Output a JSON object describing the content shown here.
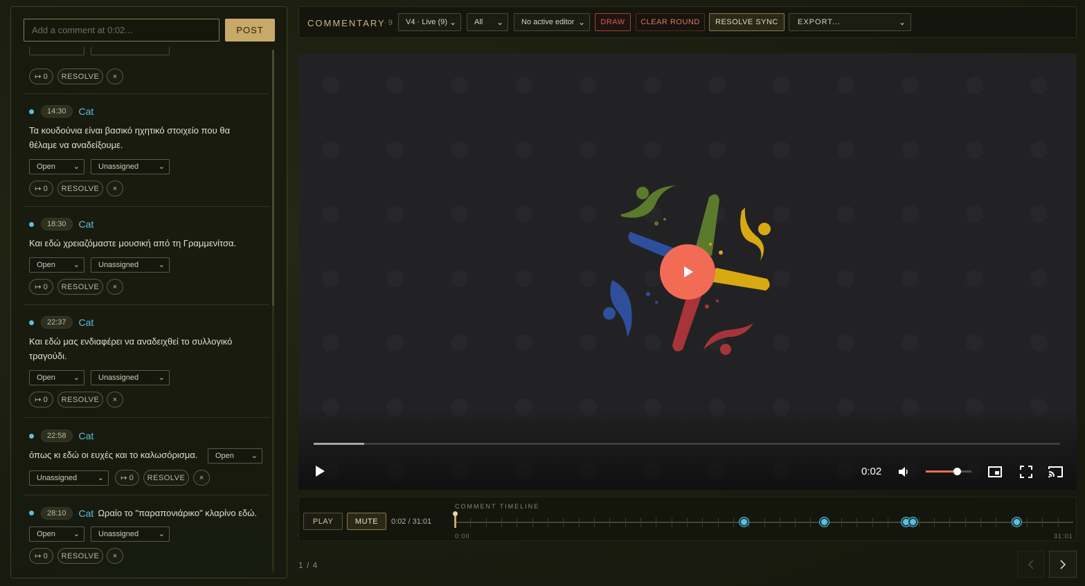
{
  "composer": {
    "placeholder": "Add a comment at 0:02...",
    "post_label": "POST"
  },
  "comment_common": {
    "status": "Open",
    "assignee": "Unassigned",
    "jump_label": "↦ 0",
    "resolve_label": "RESOLVE",
    "close_label": "×"
  },
  "comments": [
    {
      "timestamp": "14:30",
      "author": "Cat",
      "text": "Τα κουδούνια είναι βασικό ηχητικό στοιχείο που θα θέλαμε να αναδείξουμε."
    },
    {
      "timestamp": "18:30",
      "author": "Cat",
      "text": "Και εδώ χρειαζόμαστε μουσική από τη Γραμμενίτσα."
    },
    {
      "timestamp": "22:37",
      "author": "Cat",
      "text": "Και εδώ μας ενδιαφέρει να αναδειχθεί το συλλογικό τραγούδι."
    },
    {
      "timestamp": "22:58",
      "author": "Cat",
      "text": "όπως κι εδώ οι ευχές και το καλωσόρισμα."
    },
    {
      "timestamp": "28:10",
      "author": "Cat",
      "text": "Ωραίο το \"παραπονιάρικο\" κλαρίνο εδώ."
    }
  ],
  "toolbar": {
    "title": "COMMENTARY",
    "count": "· 9",
    "version_select": "V4 · Live (9)",
    "filter_select": "All",
    "editor_select": "No active editor",
    "draw_label": "DRAW",
    "clear_round_label": "CLEAR ROUND",
    "resolve_sync_label": "RESOLVE SYNC",
    "export_label": "EXPORT..."
  },
  "video": {
    "current_time": "0:02",
    "progress": 0.001,
    "volume": 0.7
  },
  "timeline": {
    "play_label": "PLAY",
    "mute_label": "MUTE",
    "time_readout": "0:02 / 31:01",
    "label": "COMMENT TIMELINE",
    "start": "0:00",
    "end": "31:01"
  },
  "pager": {
    "label": "1 / 4"
  },
  "colors": {
    "accent_gold": "#c8a96a",
    "marker_cyan": "#5bc0de",
    "play_coral": "#f26b54",
    "draw_red": "#e05a50"
  }
}
